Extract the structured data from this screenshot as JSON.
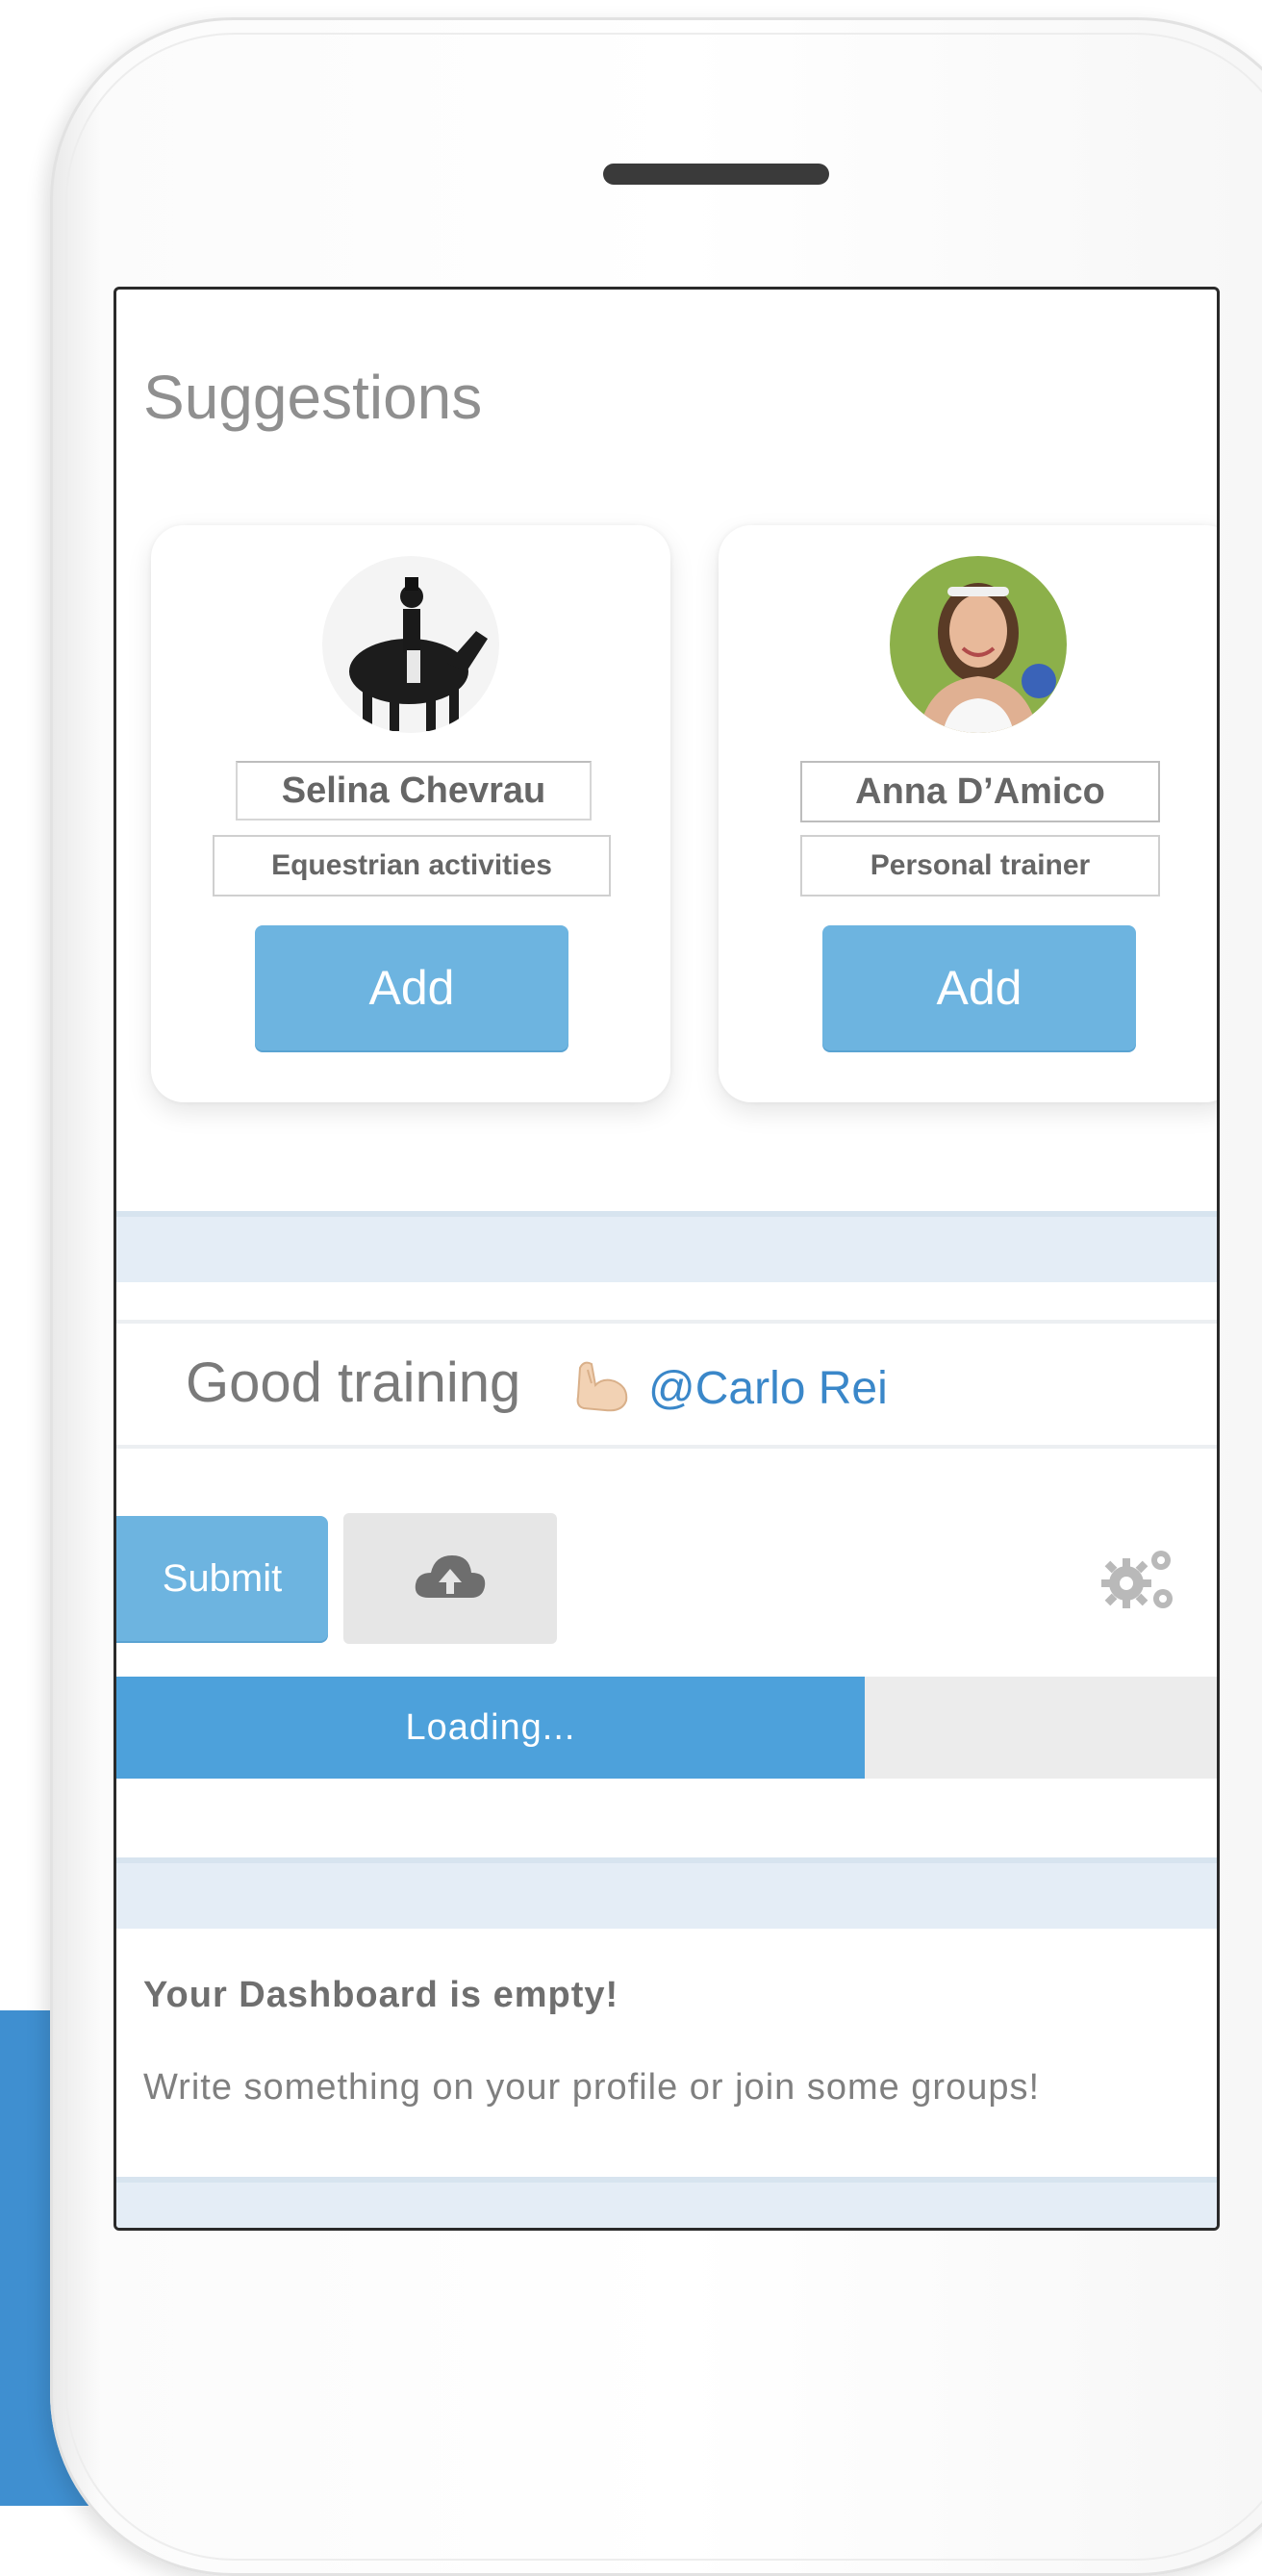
{
  "suggestions": {
    "title": "Suggestions",
    "cards": [
      {
        "name": "Selina Chevrau",
        "role": "Equestrian activities",
        "button": "Add",
        "avatar": "rider-on-horse-photo"
      },
      {
        "name": "Anna D’Amico",
        "role": "Personal trainer",
        "button": "Add",
        "avatar": "smiling-woman-photo"
      }
    ]
  },
  "post": {
    "text": "Good training",
    "emoji": "flexed-biceps-emoji",
    "mention": "@Carlo Rei"
  },
  "actions": {
    "submit_label": "Submit",
    "upload_icon": "cloud-upload-icon",
    "settings_icon": "gears-icon"
  },
  "progress": {
    "label": "Loading...",
    "fraction": 0.68
  },
  "dashboard": {
    "title": "Your Dashboard is empty!",
    "message": "Write something on your profile or join some groups!"
  },
  "colors": {
    "accent": "#4da1db",
    "button": "#6db4e0",
    "mention": "#3a87c9",
    "background_blue": "#3f8fd0"
  }
}
